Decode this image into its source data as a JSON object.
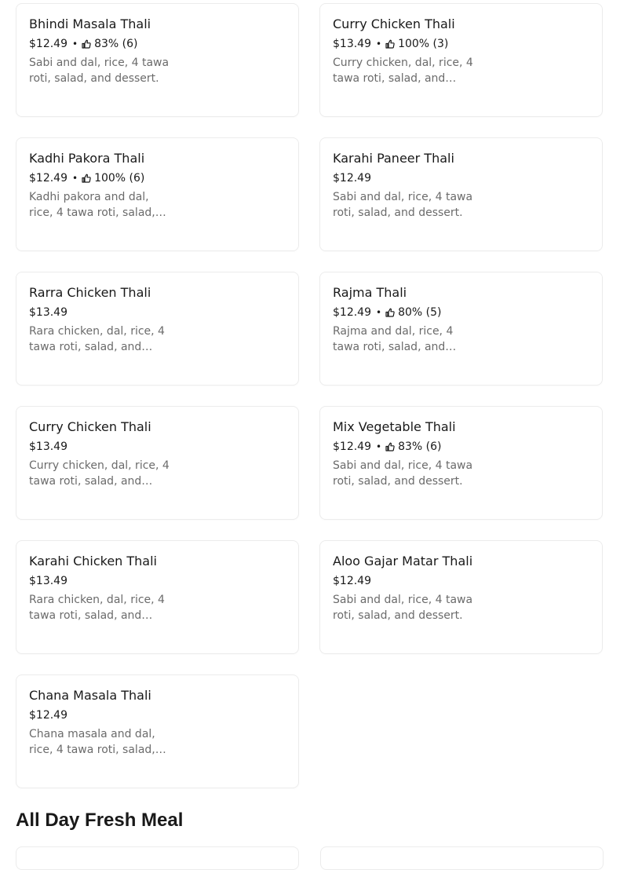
{
  "items": [
    {
      "name": "Bhindi Masala Thali",
      "price": "$12.49",
      "rating": "83% (6)",
      "desc": "Sabi and dal, rice, 4 tawa roti, salad, and dessert."
    },
    {
      "name": "Curry Chicken Thali",
      "price": "$13.49",
      "rating": "100% (3)",
      "desc": "Curry chicken, dal, rice, 4 tawa roti, salad, and…"
    },
    {
      "name": "Kadhi Pakora Thali",
      "price": "$12.49",
      "rating": "100% (6)",
      "desc": "Kadhi pakora and dal, rice, 4 tawa roti, salad,…"
    },
    {
      "name": "Karahi Paneer Thali",
      "price": "$12.49",
      "rating": null,
      "desc": "Sabi and dal, rice, 4 tawa roti, salad, and dessert."
    },
    {
      "name": "Rarra Chicken Thali",
      "price": "$13.49",
      "rating": null,
      "desc": "Rara chicken, dal, rice, 4 tawa roti, salad, and…"
    },
    {
      "name": "Rajma Thali",
      "price": "$12.49",
      "rating": "80% (5)",
      "desc": "Rajma and dal, rice, 4 tawa roti, salad, and…"
    },
    {
      "name": "Curry Chicken Thali",
      "price": "$13.49",
      "rating": null,
      "desc": "Curry chicken, dal, rice, 4 tawa roti, salad, and…"
    },
    {
      "name": "Mix Vegetable Thali",
      "price": "$12.49",
      "rating": "83% (6)",
      "desc": "Sabi and dal, rice, 4 tawa roti, salad, and dessert."
    },
    {
      "name": "Karahi Chicken Thali",
      "price": "$13.49",
      "rating": null,
      "desc": "Rara chicken, dal, rice, 4 tawa roti, salad, and…"
    },
    {
      "name": "Aloo Gajar Matar Thali",
      "price": "$12.49",
      "rating": null,
      "desc": "Sabi and dal, rice, 4 tawa roti, salad, and dessert."
    },
    {
      "name": "Chana Masala Thali",
      "price": "$12.49",
      "rating": null,
      "desc": "Chana masala and dal, rice, 4 tawa roti, salad,…"
    }
  ],
  "separator": "•",
  "thumb_icon": "thumbs-up-icon",
  "next_section": {
    "title": "All Day Fresh Meal"
  }
}
